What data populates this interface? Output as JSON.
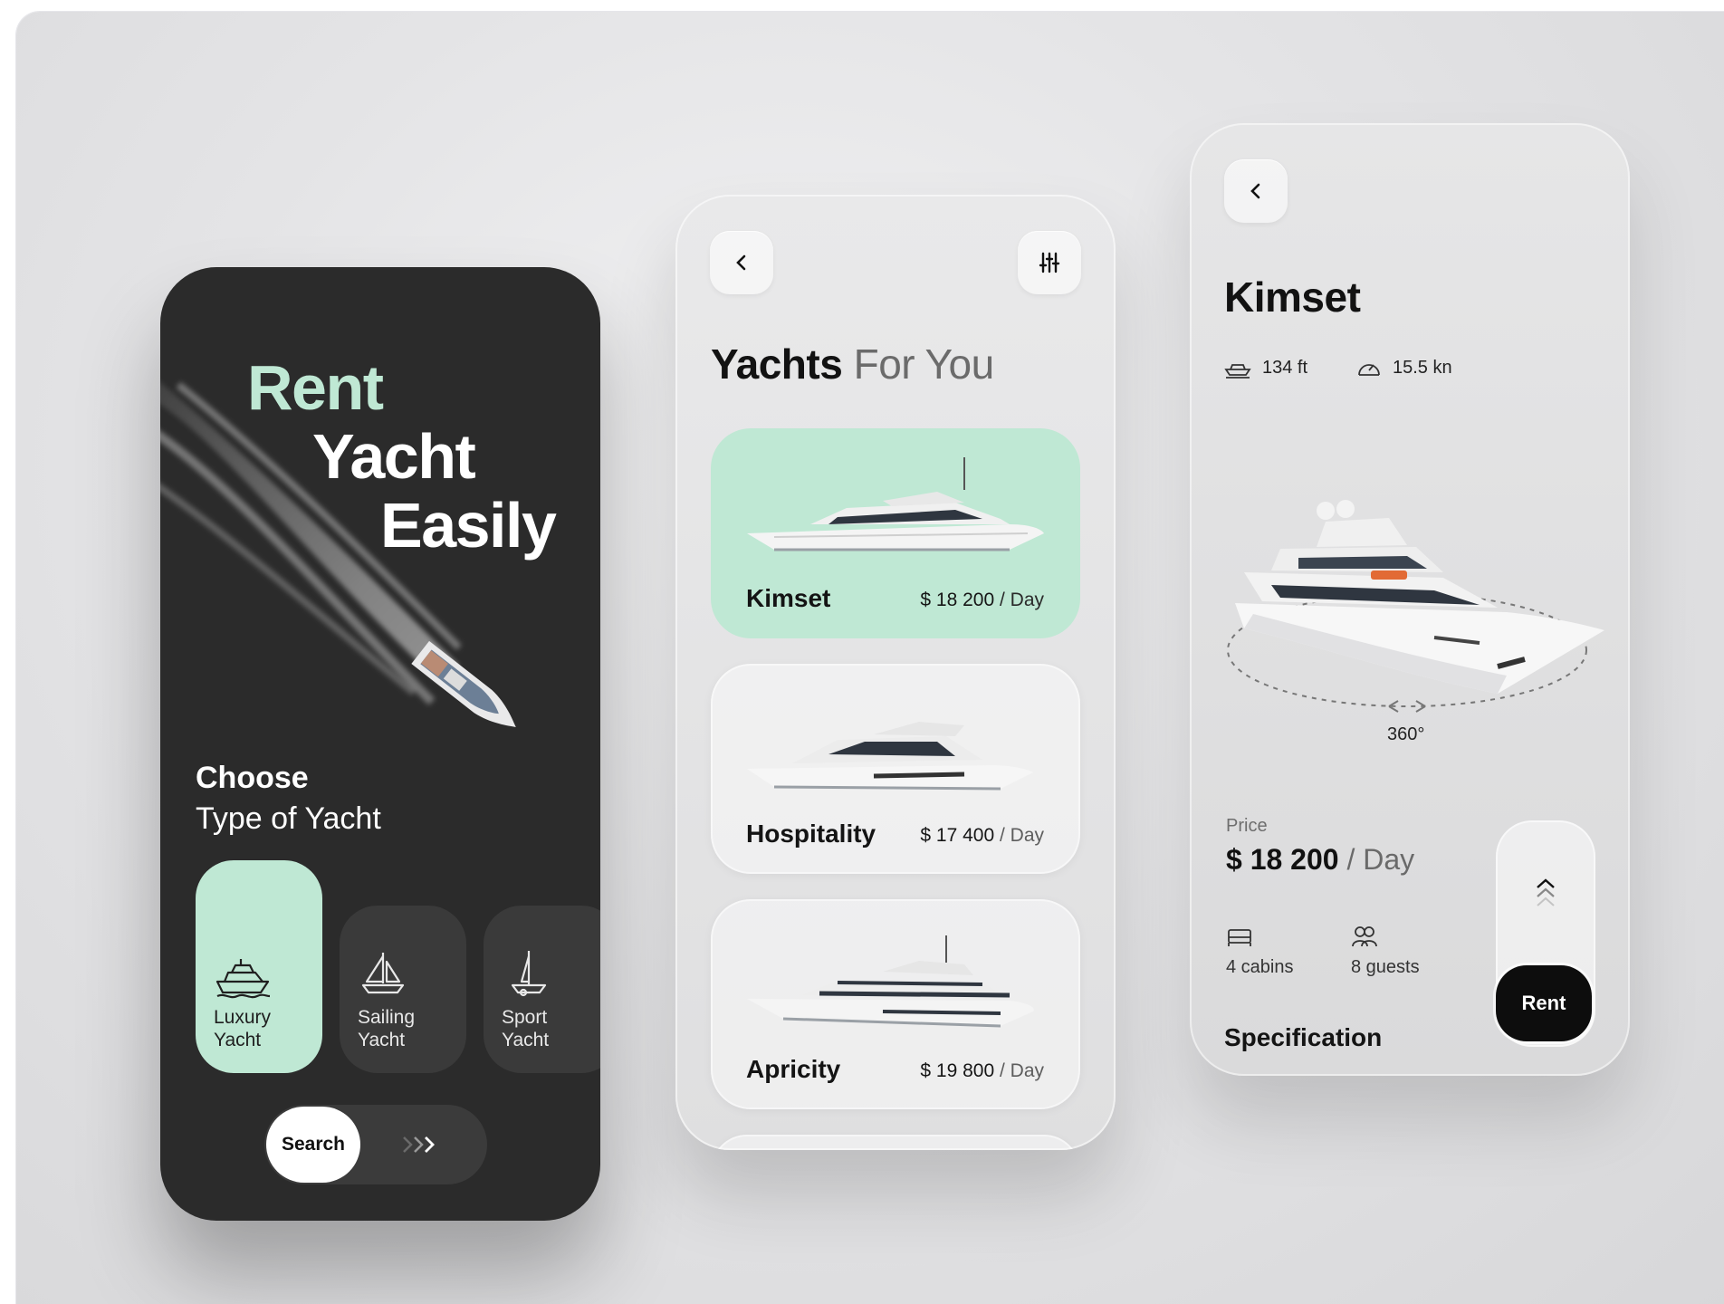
{
  "screen1": {
    "title_line1": "Rent",
    "title_line2": "Yacht",
    "title_line3": "Easily",
    "choose_line1": "Choose",
    "choose_line2": "Type of Yacht",
    "types": [
      {
        "label1": "Luxury",
        "label2": "Yacht",
        "icon": "luxury-yacht-icon",
        "active": true
      },
      {
        "label1": "Sailing",
        "label2": "Yacht",
        "icon": "sailboat-icon",
        "active": false
      },
      {
        "label1": "Sport",
        "label2": "Yacht",
        "icon": "sport-yacht-icon",
        "active": false
      }
    ],
    "search_label": "Search",
    "search_arrows": "›››"
  },
  "screen2": {
    "title_bold": "Yachts",
    "title_rest": "For You",
    "yachts": [
      {
        "name": "Kimset",
        "price": "$ 18 200",
        "unit": "/ Day",
        "active": true
      },
      {
        "name": "Hospitality",
        "price": "$ 17 400",
        "unit": "/ Day",
        "active": false
      },
      {
        "name": "Apricity",
        "price": "$ 19 800",
        "unit": "/ Day",
        "active": false
      }
    ]
  },
  "screen3": {
    "title": "Kimset",
    "length": "134 ft",
    "speed": "15.5 kn",
    "rotation_label": "360°",
    "price_label": "Price",
    "price_value": "$ 18 200",
    "price_unit": "/ Day",
    "cabins": "4 cabins",
    "guests": "8 guests",
    "spec_heading": "Specification",
    "rent_label": "Rent"
  },
  "colors": {
    "mint": "#bfe8d4",
    "dark": "#2b2b2b",
    "black": "#0d0d0d"
  }
}
